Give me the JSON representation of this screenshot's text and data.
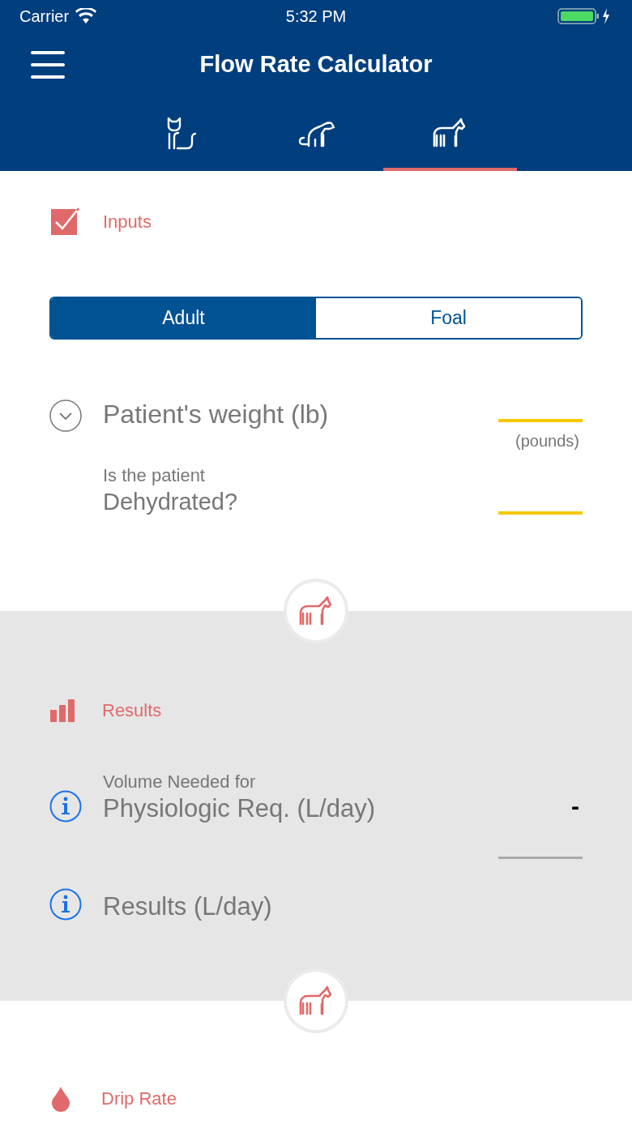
{
  "status_bar": {
    "carrier": "Carrier",
    "time": "5:32 PM"
  },
  "header": {
    "title": "Flow Rate Calculator"
  },
  "species_tabs": [
    {
      "kind": "cat",
      "selected": false
    },
    {
      "kind": "dog",
      "selected": false
    },
    {
      "kind": "horse",
      "selected": true
    }
  ],
  "inputs": {
    "title": "Inputs",
    "segments": [
      {
        "label": "Adult",
        "selected": true
      },
      {
        "label": "Foal",
        "selected": false
      }
    ],
    "fields": [
      {
        "kind": "dropdown",
        "label": "Patient's weight (lb)",
        "unit": "(pounds)"
      },
      {
        "kind": "plain",
        "caption": "Is the patient",
        "label": "Dehydrated?"
      }
    ]
  },
  "results": {
    "title": "Results",
    "rows": [
      {
        "caption": "Volume Needed for",
        "label": "Physiologic Req. (L/day)",
        "value": "-"
      },
      {
        "label": "Results (L/day)"
      }
    ]
  },
  "drip_rate": {
    "title": "Drip Rate"
  }
}
